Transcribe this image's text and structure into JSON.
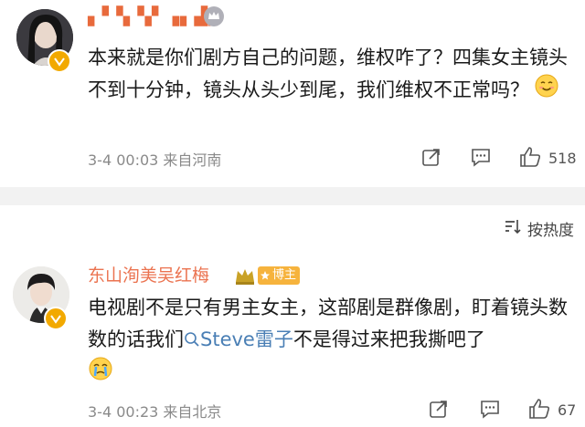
{
  "comment1": {
    "username": "▖▘▚▝▞ ▗▖▟_",
    "text": "本来就是你们剧方自己的问题，维权咋了？四集女主镜头不到十分钟，镜头从头少到尾，我们维权不正常吗？",
    "timestamp": "3-4 00:03",
    "location": "来自河南",
    "like_count": "518"
  },
  "sort": {
    "label": "按热度"
  },
  "comment2": {
    "username": "东山洵美吴红梅",
    "badge_text": "博主",
    "text_before": "电视剧不是只有男主女主，这部剧是群像剧，盯着镜头数数的话我们",
    "mention": "Steve雷子",
    "text_after": "不是得过来把我撕吧了",
    "timestamp": "3-4 00:23",
    "location": "来自北京",
    "like_count": "67"
  },
  "icons": [
    "smile-emoji-icon",
    "cry-emoji-icon",
    "verified-icon",
    "share-icon",
    "reply-icon",
    "like-icon",
    "sort-icon",
    "search-icon",
    "level-crown-icon"
  ],
  "colors": {
    "username_orange": "#eb7350",
    "mention_blue": "#4a7fb5",
    "verified_gold": "#f2a900",
    "meta_gray": "#8a8a8a"
  }
}
